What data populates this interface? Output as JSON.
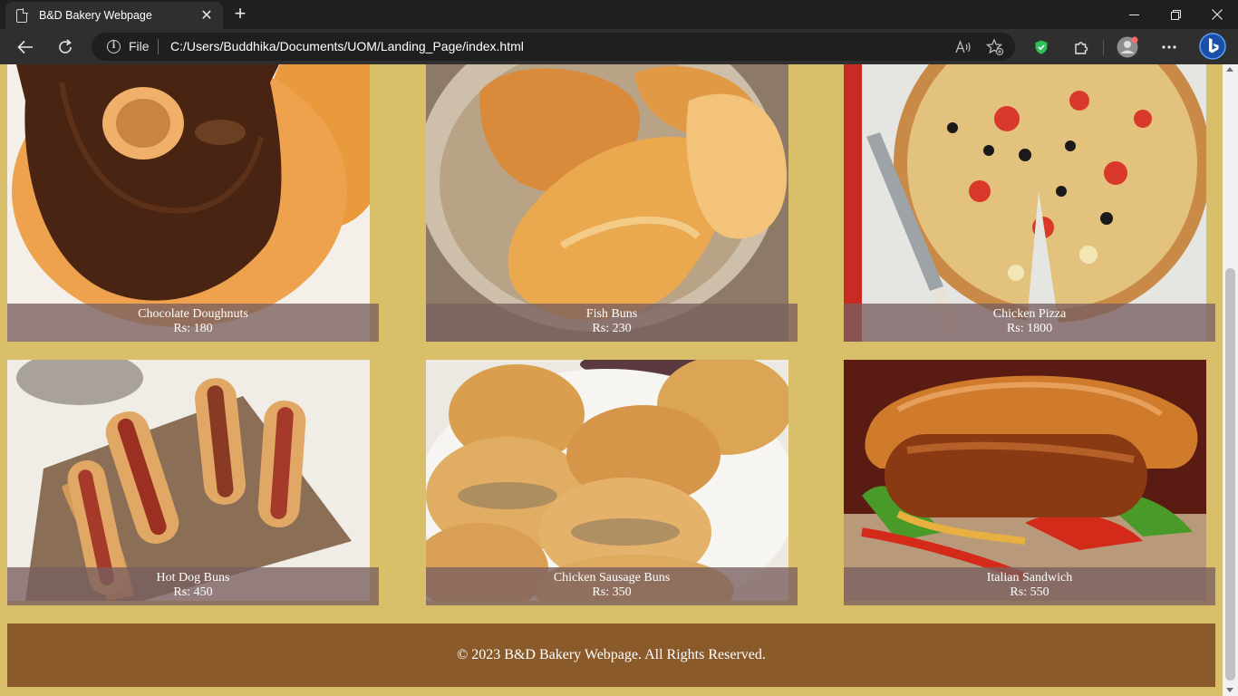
{
  "browser": {
    "tab_title": "B&D Bakery Webpage",
    "new_tab_glyph": "+",
    "close_glyph": "✕",
    "scheme_label": "File",
    "url": "C:/Users/Buddhika/Documents/UOM/Landing_Page/index.html",
    "icons": [
      "document-icon",
      "back-arrow-icon",
      "refresh-icon",
      "info-icon",
      "read-aloud-icon",
      "add-favorite-icon",
      "shield-icon",
      "extensions-icon",
      "profile-avatar-icon",
      "more-menu-icon",
      "bing-copilot-icon",
      "minimize-icon",
      "restore-icon",
      "close-window-icon"
    ]
  },
  "products": [
    {
      "name": "Chocolate Doughnuts",
      "price": "Rs: 180",
      "image": "chocolate-doughnut-photo"
    },
    {
      "name": "Fish Buns",
      "price": "Rs: 230",
      "image": "fish-buns-photo"
    },
    {
      "name": "Chicken Pizza",
      "price": "Rs: 1800",
      "image": "chicken-pizza-photo"
    },
    {
      "name": "Hot Dog Buns",
      "price": "Rs: 450",
      "image": "hot-dog-buns-photo"
    },
    {
      "name": "Chicken Sausage Buns",
      "price": "Rs: 350",
      "image": "chicken-sausage-buns-photo"
    },
    {
      "name": "Italian Sandwich",
      "price": "Rs: 550",
      "image": "italian-sandwich-photo"
    }
  ],
  "footer": {
    "text": "© 2023 B&D Bakery Webpage. All Rights Reserved."
  },
  "colors": {
    "page_background": "#d9bf6a",
    "caption_overlay": "#785f5f",
    "footer_background": "#8a5a2a",
    "browser_frame": "#1f1f1f",
    "browser_toolbar": "#2f2f2f"
  }
}
